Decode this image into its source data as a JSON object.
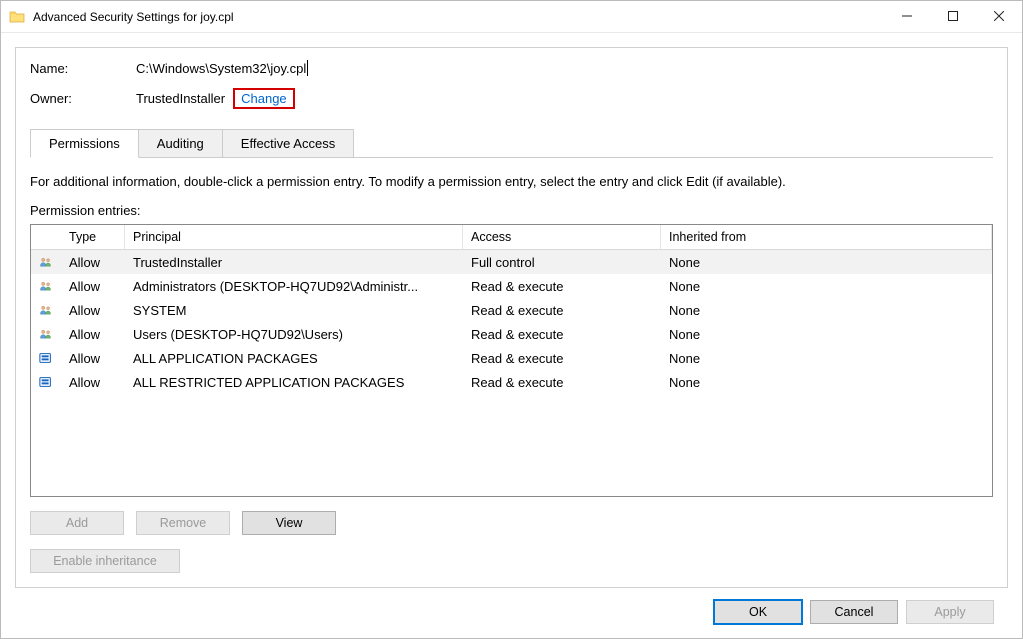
{
  "window": {
    "title": "Advanced Security Settings for joy.cpl"
  },
  "fields": {
    "name_label": "Name:",
    "name_value": "C:\\Windows\\System32\\joy.cpl",
    "owner_label": "Owner:",
    "owner_value": "TrustedInstaller",
    "change_link": "Change"
  },
  "tabs": {
    "permissions": "Permissions",
    "auditing": "Auditing",
    "effective": "Effective Access"
  },
  "info_text": "For additional information, double-click a permission entry. To modify a permission entry, select the entry and click Edit (if available).",
  "entries_label": "Permission entries:",
  "columns": {
    "type": "Type",
    "principal": "Principal",
    "access": "Access",
    "inherited": "Inherited from"
  },
  "entries": [
    {
      "icon": "users",
      "type": "Allow",
      "principal": "TrustedInstaller",
      "access": "Full control",
      "inherited": "None",
      "selected": true
    },
    {
      "icon": "users",
      "type": "Allow",
      "principal": "Administrators (DESKTOP-HQ7UD92\\Administr...",
      "access": "Read & execute",
      "inherited": "None"
    },
    {
      "icon": "users",
      "type": "Allow",
      "principal": "SYSTEM",
      "access": "Read & execute",
      "inherited": "None"
    },
    {
      "icon": "users",
      "type": "Allow",
      "principal": "Users (DESKTOP-HQ7UD92\\Users)",
      "access": "Read & execute",
      "inherited": "None"
    },
    {
      "icon": "package",
      "type": "Allow",
      "principal": "ALL APPLICATION PACKAGES",
      "access": "Read & execute",
      "inherited": "None"
    },
    {
      "icon": "package",
      "type": "Allow",
      "principal": "ALL RESTRICTED APPLICATION PACKAGES",
      "access": "Read & execute",
      "inherited": "None"
    }
  ],
  "buttons": {
    "add": "Add",
    "remove": "Remove",
    "view": "View",
    "enable_inheritance": "Enable inheritance",
    "ok": "OK",
    "cancel": "Cancel",
    "apply": "Apply"
  }
}
